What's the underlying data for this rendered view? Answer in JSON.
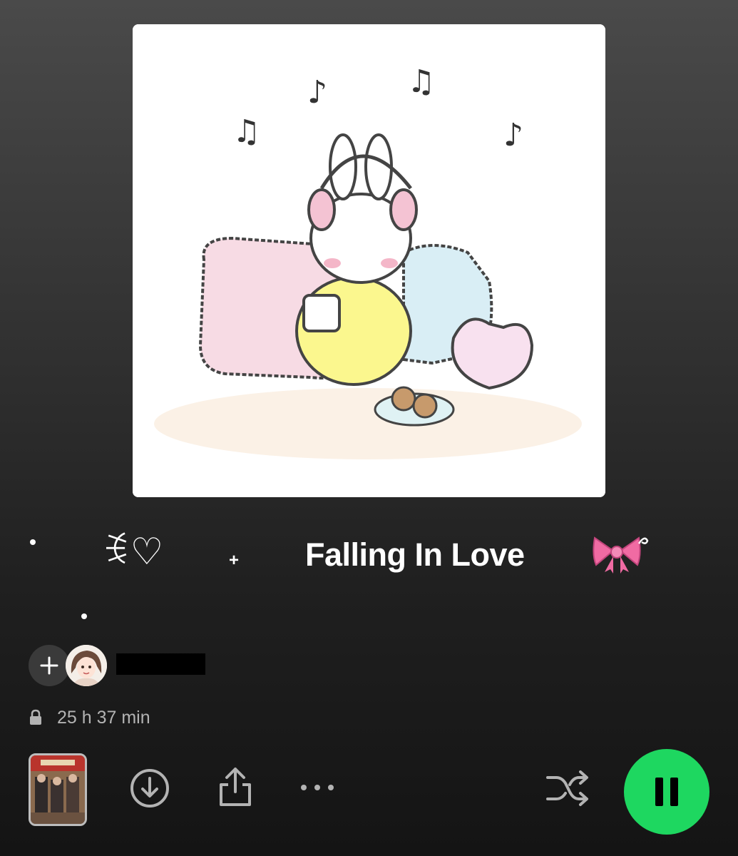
{
  "playlist": {
    "title": "Falling In Love",
    "decor_heart": "ꉂ♡",
    "decor_plus": "+",
    "owner_name": "██████",
    "duration": "25 h 37 min"
  },
  "icons": {
    "add": "plus-icon",
    "lock": "lock-icon",
    "download": "download-icon",
    "share": "share-icon",
    "more": "more-icon",
    "shuffle": "shuffle-icon",
    "pause": "pause-icon"
  },
  "colors": {
    "accent": "#1ed760",
    "muted_text": "#b3b3b3",
    "background_top": "#4a4a4a",
    "background_bottom": "#141414"
  }
}
